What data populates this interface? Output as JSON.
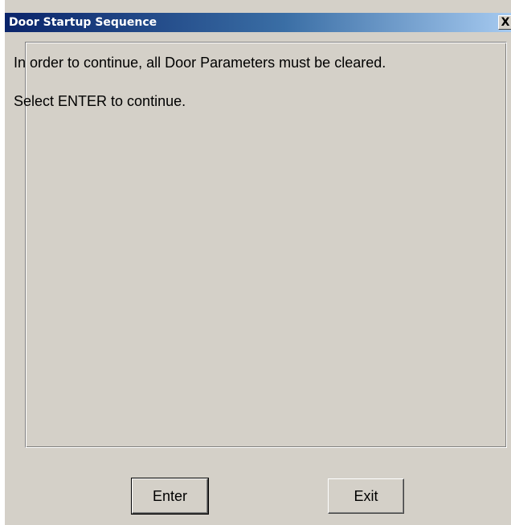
{
  "window": {
    "title": "Door Startup Sequence",
    "close_glyph": "X"
  },
  "message": {
    "line1": "In order to continue, all Door Parameters must be cleared.",
    "line2": "Select ENTER to continue."
  },
  "buttons": {
    "enter_label": "Enter",
    "exit_label": "Exit"
  },
  "colors": {
    "title_bar_start": "#0a246a",
    "title_bar_end": "#a6caf0",
    "face": "#d4d0c8"
  }
}
